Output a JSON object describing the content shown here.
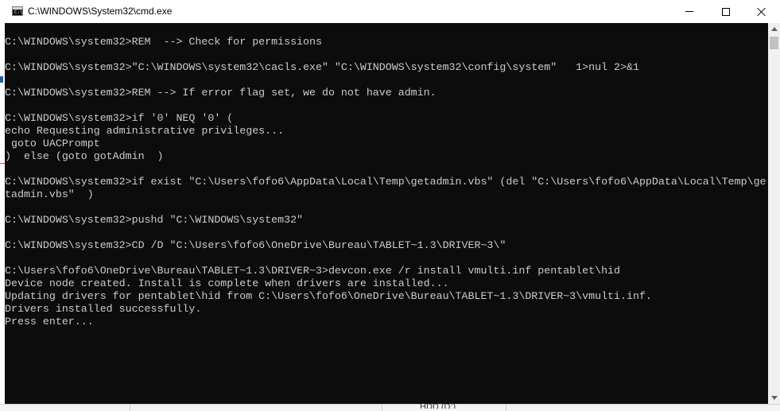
{
  "window": {
    "title": "C:\\WINDOWS\\System32\\cmd.exe",
    "icon": "console-app-icon",
    "icon_glyph": "C:\\_",
    "controls": {
      "minimize_icon": "minimize-icon",
      "maximize_icon": "maximize-icon",
      "close_icon": "close-icon"
    }
  },
  "console": {
    "background": "#0c0c0c",
    "foreground": "#cccccc",
    "lines": [
      "C:\\WINDOWS\\system32>REM  --> Check for permissions",
      "",
      "C:\\WINDOWS\\system32>\"C:\\WINDOWS\\system32\\cacls.exe\" \"C:\\WINDOWS\\system32\\config\\system\"   1>nul 2>&1",
      "",
      "C:\\WINDOWS\\system32>REM --> If error flag set, we do not have admin.",
      "",
      "C:\\WINDOWS\\system32>if '0' NEQ '0' (",
      "echo Requesting administrative privileges...",
      " goto UACPrompt",
      ")  else (goto gotAdmin  )",
      "",
      "C:\\WINDOWS\\system32>if exist \"C:\\Users\\fofo6\\AppData\\Local\\Temp\\getadmin.vbs\" (del \"C:\\Users\\fofo6\\AppData\\Local\\Temp\\ge",
      "tadmin.vbs\"  )",
      "",
      "C:\\WINDOWS\\system32>pushd \"C:\\WINDOWS\\system32\"",
      "",
      "C:\\WINDOWS\\system32>CD /D \"C:\\Users\\fofo6\\OneDrive\\Bureau\\TABLET~1.3\\DRIVER~3\\\"",
      "",
      "C:\\Users\\fofo6\\OneDrive\\Bureau\\TABLET~1.3\\DRIVER~3>devcon.exe /r install vmulti.inf pentablet\\hid",
      "Device node created. Install is complete when drivers are installed...",
      "Updating drivers for pentablet\\hid from C:\\Users\\fofo6\\OneDrive\\Bureau\\TABLET~1.3\\DRIVER~3\\vmulti.inf.",
      "Drivers installed successfully.",
      "Press enter..."
    ]
  },
  "scrollbar": {
    "up_icon": "scroll-up-arrow-icon",
    "down_icon": "scroll-down-arrow-icon"
  },
  "background_window": {
    "peek_text": "HDD (D:)"
  }
}
